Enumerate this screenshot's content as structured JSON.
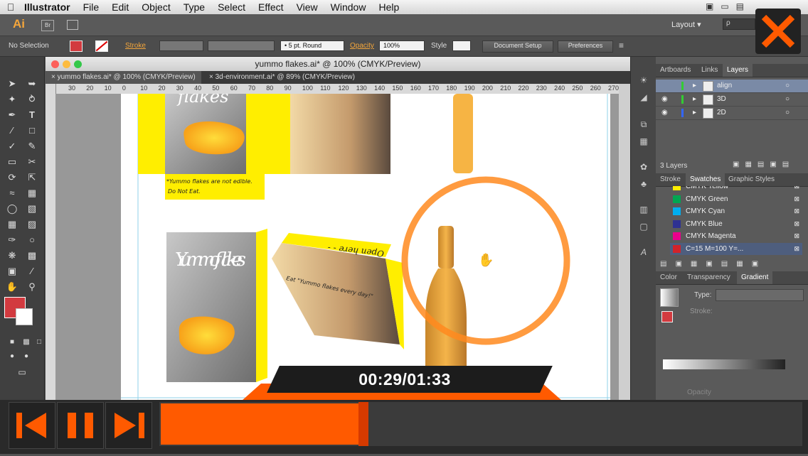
{
  "menubar": {
    "app_name": "Illustrator",
    "items": [
      "File",
      "Edit",
      "Object",
      "Type",
      "Select",
      "Effect",
      "View",
      "Window",
      "Help"
    ]
  },
  "appbar": {
    "logo": "Ai",
    "bridge": "Br",
    "workspace": "Layout",
    "search_placeholder": "ρ"
  },
  "control": {
    "selection": "No Selection",
    "stroke_label": "Stroke",
    "brush": "5 pt. Round",
    "opacity_label": "Opacity",
    "opacity_value": "100%",
    "style_label": "Style",
    "document_setup": "Document Setup",
    "preferences": "Preferences"
  },
  "document": {
    "title": "yummo flakes.ai* @ 100% (CMYK/Preview)",
    "tabs": [
      "yummo flakes.ai* @ 100% (CMYK/Preview)",
      "3d-environment.ai* @ 89% (CMYK/Preview)"
    ],
    "hruler": [
      "30",
      "20",
      "10",
      "0",
      "10",
      "20",
      "30",
      "40",
      "50",
      "60",
      "70",
      "80",
      "90",
      "100",
      "110",
      "120",
      "130",
      "140",
      "150",
      "160",
      "170",
      "180",
      "190",
      "200",
      "210",
      "220",
      "230",
      "240",
      "250",
      "260",
      "270"
    ],
    "art": {
      "box_title_top": "flakes",
      "box_title": "Yummo flakes",
      "box_note_1": "*Yummo flakes are not edible.",
      "box_note_2": "Do Not Eat.",
      "open_here": "Open here - -",
      "eat_text": "Eat \"Yummo flakes every day!\""
    }
  },
  "panels": {
    "top_tabs": [
      "Artboards",
      "Links",
      "Layers"
    ],
    "layers": [
      {
        "name": "align",
        "color": "#33cc33"
      },
      {
        "name": "3D",
        "color": "#33cc33"
      },
      {
        "name": "2D",
        "color": "#3366ff"
      }
    ],
    "layers_count": "3 Layers",
    "mid_tabs": [
      "Stroke",
      "Swatches",
      "Graphic Styles"
    ],
    "swatches": [
      {
        "name": "CMYK Yellow",
        "color": "#ffee00"
      },
      {
        "name": "CMYK Green",
        "color": "#00a651"
      },
      {
        "name": "CMYK Cyan",
        "color": "#00aeef"
      },
      {
        "name": "CMYK Blue",
        "color": "#2e3192"
      },
      {
        "name": "CMYK Magenta",
        "color": "#ec008c"
      },
      {
        "name": "C=15 M=100 Y=...",
        "color": "#d2232a"
      }
    ],
    "bottom_tabs": [
      "Color",
      "Transparency",
      "Gradient"
    ],
    "gradient": {
      "type_label": "Type:",
      "stroke_label": "Stroke:",
      "opacity_label": "Opacity"
    }
  },
  "player": {
    "time": "00:29/01:33",
    "progress": 0.32
  }
}
